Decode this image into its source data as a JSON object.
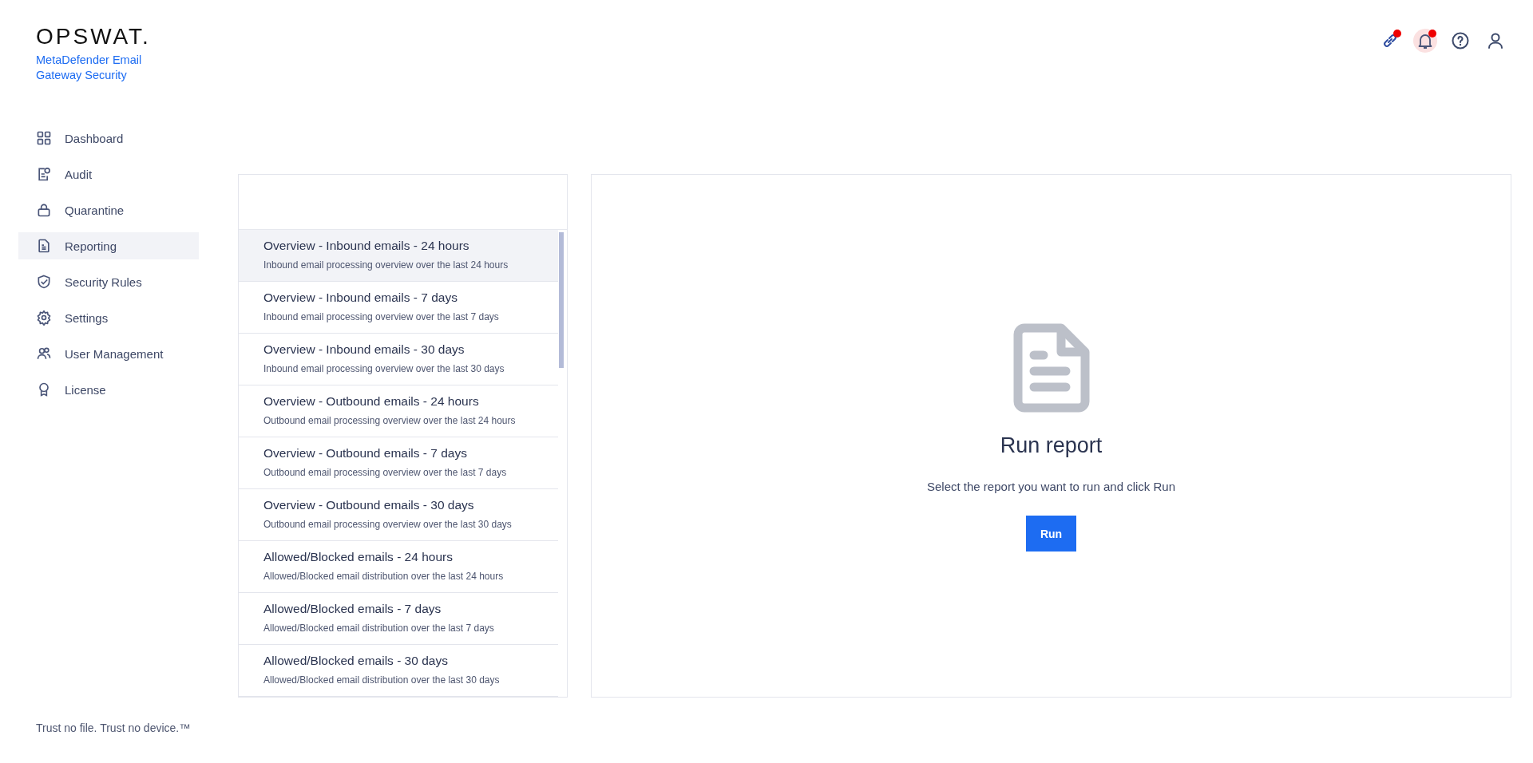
{
  "brand": {
    "logo": "OPSWAT.",
    "product": "MetaDefender Email Gateway Security"
  },
  "header_icons": [
    {
      "kind": "link",
      "alert": true
    },
    {
      "kind": "bell",
      "alert": true
    },
    {
      "kind": "help",
      "alert": false
    },
    {
      "kind": "user",
      "alert": false
    }
  ],
  "sidebar": {
    "items": [
      {
        "kind": "dashboard",
        "label": "Dashboard",
        "selected": false
      },
      {
        "kind": "audit",
        "label": "Audit",
        "selected": false
      },
      {
        "kind": "quarantine",
        "label": "Quarantine",
        "selected": false
      },
      {
        "kind": "reporting",
        "label": "Reporting",
        "selected": true
      },
      {
        "kind": "security",
        "label": "Security Rules",
        "selected": false
      },
      {
        "kind": "settings",
        "label": "Settings",
        "selected": false
      },
      {
        "kind": "users",
        "label": "User Management",
        "selected": false
      },
      {
        "kind": "license",
        "label": "License",
        "selected": false
      }
    ],
    "footer": "Trust no file. Trust no device.™"
  },
  "reports": [
    {
      "title": "Overview - Inbound emails - 24 hours",
      "description": "Inbound email processing overview over the last 24 hours",
      "selected": true
    },
    {
      "title": "Overview - Inbound emails - 7 days",
      "description": "Inbound email processing overview over the last 7 days",
      "selected": false
    },
    {
      "title": "Overview - Inbound emails - 30 days",
      "description": "Inbound email processing overview over the last 30 days",
      "selected": false
    },
    {
      "title": "Overview - Outbound emails - 24 hours",
      "description": "Outbound email processing overview over the last 24 hours",
      "selected": false
    },
    {
      "title": "Overview - Outbound emails - 7 days",
      "description": "Outbound email processing overview over the last 7 days",
      "selected": false
    },
    {
      "title": "Overview - Outbound emails - 30 days",
      "description": "Outbound email processing overview over the last 30 days",
      "selected": false
    },
    {
      "title": "Allowed/Blocked emails - 24 hours",
      "description": "Allowed/Blocked email distribution over the last 24 hours",
      "selected": false
    },
    {
      "title": "Allowed/Blocked emails - 7 days",
      "description": "Allowed/Blocked email distribution over the last 7 days",
      "selected": false
    },
    {
      "title": "Allowed/Blocked emails - 30 days",
      "description": "Allowed/Blocked email distribution over the last 30 days",
      "selected": false
    }
  ],
  "run_panel": {
    "title": "Run report",
    "message": "Select the report you want to run and click Run",
    "button": "Run"
  }
}
